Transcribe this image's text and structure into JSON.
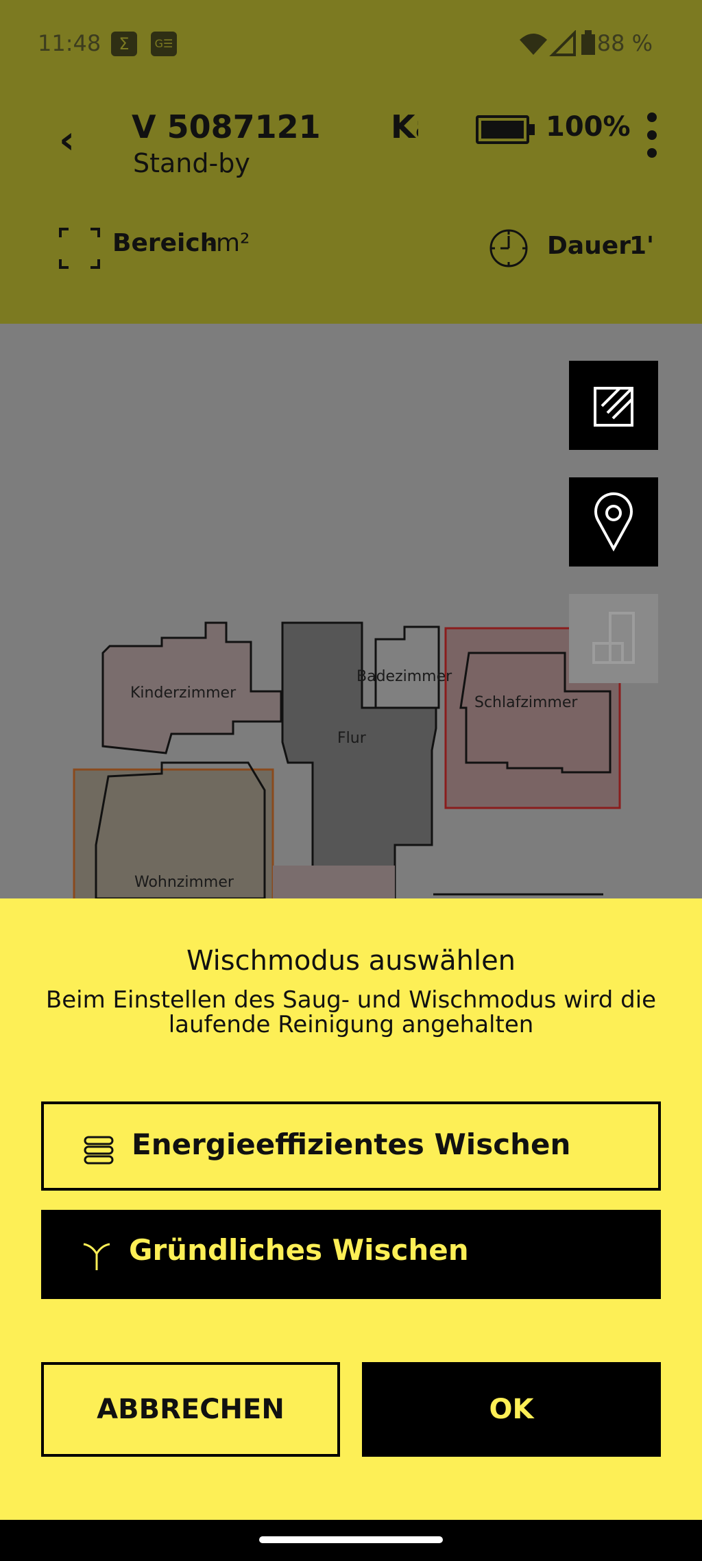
{
  "status_bar": {
    "time": "11:48",
    "battery_pct": "88 %"
  },
  "header": {
    "device_name": "V 5087121",
    "status": "Stand-by",
    "clipped_text": "Ka",
    "battery": "100%",
    "area_label": "Bereich",
    "area_value": "-m²",
    "duration_label": "Dauer",
    "duration_value": "1'"
  },
  "map": {
    "rooms": [
      "Kinderzimmer",
      "Badezimmer",
      "Schlafzimmer",
      "Flur",
      "Wohnzimmer"
    ]
  },
  "sheet": {
    "title": "Wischmodus auswählen",
    "subtitle": "Beim Einstellen des Saug- und Wischmodus wird die laufende Reinigung angehalten",
    "options": [
      {
        "label": "Energieeffizientes Wischen",
        "icon": "layers-icon",
        "selected": false
      },
      {
        "label": "Gründliches Wischen",
        "icon": "sprout-icon",
        "selected": true
      }
    ],
    "cancel": "ABBRECHEN",
    "ok": "OK"
  }
}
